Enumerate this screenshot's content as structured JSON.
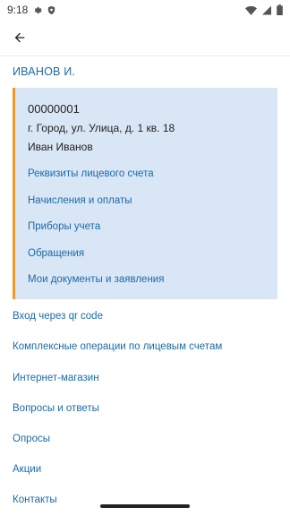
{
  "status": {
    "time": "9:18"
  },
  "user": {
    "name": "ИВАНОВ И."
  },
  "account": {
    "number": "00000001",
    "address": "г. Город, ул. Улица, д. 1 кв. 18",
    "owner": "Иван Иванов",
    "links": [
      "Реквизиты лицевого счета",
      "Начисления и оплаты",
      "Приборы учета",
      "Обращения",
      "Мои документы и заявления"
    ]
  },
  "menu": [
    "Вход через qr code",
    "Комплексные операции по лицевым счетам",
    "Интернет-магазин",
    "Вопросы и ответы",
    "Опросы",
    "Акции",
    "Контакты"
  ],
  "colors": {
    "accent": "#1c6aa8",
    "card_bg": "#d9e6f6",
    "card_border": "#f19a2a"
  }
}
